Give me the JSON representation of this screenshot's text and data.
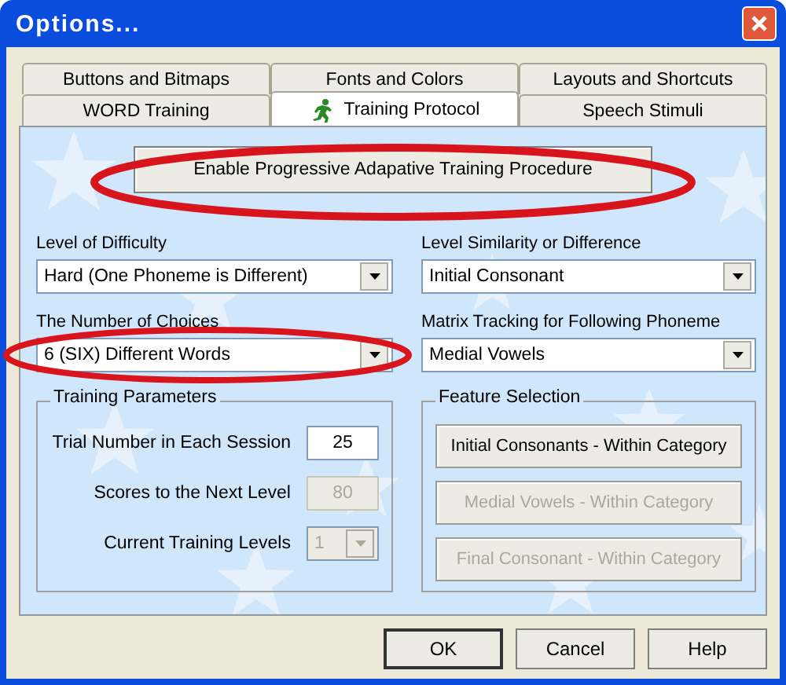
{
  "window": {
    "title": "Options..."
  },
  "tab_rows": [
    [
      {
        "kind": "plain",
        "label": "Buttons and Bitmaps",
        "selected": false
      },
      {
        "kind": "plain",
        "label": "Fonts and Colors",
        "selected": false
      },
      {
        "kind": "plain",
        "label": "Layouts and Shortcuts",
        "selected": false
      }
    ],
    [
      {
        "kind": "plain",
        "label": "WORD Training",
        "selected": false
      },
      {
        "kind": "icon",
        "label": "Training Protocol",
        "selected": true
      },
      {
        "kind": "plain",
        "label": "Speech Stimuli",
        "selected": false
      }
    ]
  ],
  "enable_button": {
    "label": "Enable Progressive Adapative Training Procedure"
  },
  "selectors": [
    {
      "label": "Level of Difficulty",
      "value": "Hard (One Phoneme is Different)"
    },
    {
      "label": "Level Similarity or Difference",
      "value": "Initial Consonant"
    },
    {
      "label": "The Number of Choices",
      "value": "6 (SIX) Different Words"
    },
    {
      "label": "Matrix Tracking for Following Phoneme",
      "value": "Medial Vowels"
    }
  ],
  "training_parameters": {
    "title": "Training Parameters",
    "fields": [
      {
        "kind": "text",
        "label": "Trial Number in Each Session",
        "value": "25",
        "disabled": false
      },
      {
        "kind": "text",
        "label": "Scores to the  Next Level",
        "value": "80",
        "disabled": true
      },
      {
        "kind": "combo",
        "label": "Current Training Levels",
        "value": "1",
        "disabled": true
      }
    ]
  },
  "feature_selection": {
    "title": "Feature Selection",
    "buttons": [
      {
        "label": "Initial Consonants - Within Category",
        "disabled": false
      },
      {
        "label": "Medial Vowels - Within Category",
        "disabled": true
      },
      {
        "label": "Final Consonant - Within Category",
        "disabled": true
      }
    ]
  },
  "buttons": [
    {
      "label": "OK",
      "default": true
    },
    {
      "label": "Cancel",
      "default": false
    },
    {
      "label": "Help",
      "default": false
    }
  ]
}
